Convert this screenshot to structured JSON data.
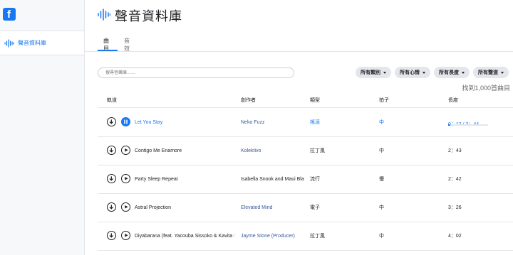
{
  "app": {
    "title": "聲音資料庫",
    "logo_letter": "f"
  },
  "sidebar": {
    "items": [
      {
        "label": "聲音資料庫",
        "icon": "soundwave-icon",
        "active": true
      }
    ]
  },
  "tabs": [
    {
      "label": "曲目",
      "active": true
    },
    {
      "label": "音效",
      "active": false
    }
  ],
  "search": {
    "placeholder": "搜尋音樂庫……",
    "value": ""
  },
  "filters": [
    {
      "label": "所有類別"
    },
    {
      "label": "所有心情"
    },
    {
      "label": "所有長度"
    },
    {
      "label": "所有聲道"
    }
  ],
  "result_count": "找到1,000首曲目",
  "columns": {
    "track": "軌道",
    "artist": "創作者",
    "genre": "類型",
    "tempo": "拍子",
    "length": "長度"
  },
  "tracks": [
    {
      "title": "Let You Stay",
      "artist": "Neko Fuzz",
      "genre": "搖滾",
      "tempo": "中",
      "length": "0：12 / 3：44",
      "playing": true,
      "progress": 0.054
    },
    {
      "title": "Contigo Me Enamore",
      "artist": "Kolektivo",
      "genre": "拉丁風",
      "tempo": "中",
      "length": "2：43",
      "playing": false
    },
    {
      "title": "Party Sleep Repeat",
      "artist": "Isabella Snook and Maui Bla",
      "genre": "流行",
      "tempo": "慢",
      "length": "2：42",
      "playing": false
    },
    {
      "title": "Astral Projection",
      "artist": "Elevated Mind",
      "genre": "電子",
      "tempo": "中",
      "length": "3：26",
      "playing": false
    },
    {
      "title": "Diyabarana (feat. Yacouba Sissoko & Kavita S",
      "artist": "Jayme Stone (Producer)",
      "genre": "拉丁風",
      "tempo": "中",
      "length": "4：02",
      "playing": false
    }
  ],
  "colors": {
    "accent": "#1877f2",
    "artist_link": "#385898",
    "sidebar_bg": "#f7f8fa",
    "filter_bg": "#e4e6eb"
  }
}
